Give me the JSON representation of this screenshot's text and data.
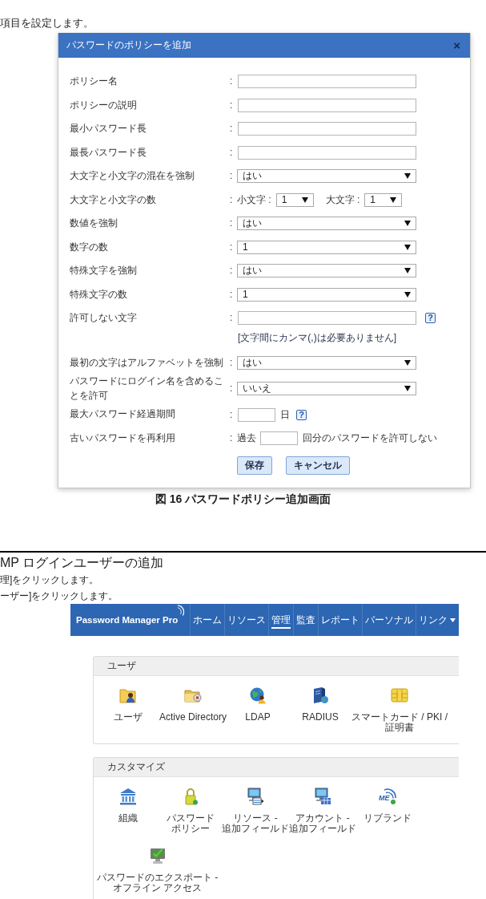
{
  "intro": "項目を設定します。",
  "dialog": {
    "title": "パスワードのポリシーを追加",
    "close": "×",
    "rows": [
      {
        "kind": "text",
        "label": "ポリシー名",
        "colon": ":"
      },
      {
        "kind": "text",
        "label": "ポリシーの説明",
        "colon": ":"
      },
      {
        "kind": "text",
        "label": "最小パスワード長",
        "colon": ":"
      },
      {
        "kind": "text",
        "label": "最長パスワード長",
        "colon": ":"
      },
      {
        "kind": "select",
        "label": "大文字と小文字の混在を強制",
        "colon": ":",
        "value": "はい"
      },
      {
        "kind": "pair",
        "label": "大文字と小文字の数",
        "colon": ":",
        "selects": [
          {
            "label": "小文字 :",
            "value": "1"
          },
          {
            "label": "大文字 :",
            "value": "1"
          }
        ]
      },
      {
        "kind": "select",
        "label": "数値を強制",
        "colon": ":",
        "value": "はい"
      },
      {
        "kind": "select",
        "label": "数字の数",
        "colon": ":",
        "value": "1"
      },
      {
        "kind": "select",
        "label": "特殊文字を強制",
        "colon": ":",
        "value": "はい"
      },
      {
        "kind": "select",
        "label": "特殊文字の数",
        "colon": ":",
        "value": "1"
      },
      {
        "kind": "text",
        "label": "許可しない文字",
        "colon": ":",
        "help": "?",
        "hint": "[文字間にカンマ(,)は必要ありません]"
      },
      {
        "kind": "select",
        "label": "最初の文字はアルファベットを強制",
        "colon": ":",
        "value": "はい"
      },
      {
        "kind": "select",
        "label": "パスワードにログイン名を含めることを許可",
        "colon": ":",
        "value": "いいえ"
      },
      {
        "kind": "days",
        "label": "最大パスワード経過期間",
        "colon": ":",
        "unit": "日",
        "help": "?"
      },
      {
        "kind": "reuse",
        "label": "古いパスワードを再利用",
        "colon": ":",
        "prefix": "過去",
        "suffix": "回分のパスワードを許可しない"
      }
    ],
    "buttons": [
      "保存",
      "キャンセル"
    ]
  },
  "caption": "図 16 パスワードポリシー追加画面",
  "section": {
    "heading": "MP ログインユーザーの追加",
    "steps": [
      "理]をクリックします。",
      "ーザー]をクリックします。"
    ]
  },
  "app": {
    "logo": "Password Manager Pro",
    "nav": [
      {
        "label": "ホーム",
        "selected": false,
        "dropdown": false
      },
      {
        "label": "リソース",
        "selected": false,
        "dropdown": false
      },
      {
        "label": "管理",
        "selected": true,
        "dropdown": false
      },
      {
        "label": "監査",
        "selected": false,
        "dropdown": false
      },
      {
        "label": "レポート",
        "selected": false,
        "dropdown": false
      },
      {
        "label": "パーソナル",
        "selected": false,
        "dropdown": false
      },
      {
        "label": "リンク",
        "selected": false,
        "dropdown": true
      }
    ],
    "panels": [
      {
        "title": "ユーザ",
        "items": [
          {
            "label": "ユーザ"
          },
          {
            "label": "Active Directory"
          },
          {
            "label": "LDAP"
          },
          {
            "label": "RADIUS"
          },
          {
            "label": "スマートカード / PKI /\n証明書"
          }
        ]
      },
      {
        "title": "カスタマイズ",
        "items": [
          {
            "label": "組織"
          },
          {
            "label": "パスワードポリシー"
          },
          {
            "label": "リソース -\n追加フィールド"
          },
          {
            "label": "アカウント -\n追加フィールド"
          },
          {
            "label": "リブランド",
            "logo_text": "ME"
          },
          {
            "label": "パスワードのエクスポート -\nオフライン アクセス"
          }
        ]
      }
    ]
  }
}
